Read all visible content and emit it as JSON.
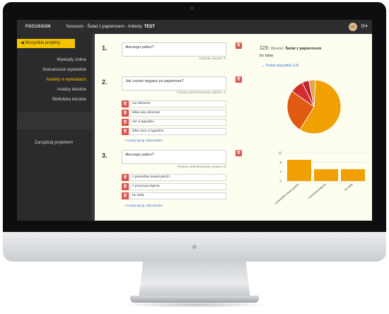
{
  "header": {
    "logo": "FOCUSSON",
    "crumb_app": "focusson",
    "crumb_sep": " · ",
    "crumb_project": "Świat z papierosem",
    "crumb_dash": " - Ankiety: ",
    "crumb_survey": "TEST",
    "avatar_text": "NAP"
  },
  "sidebar": {
    "all_projects": "Wszystkie projekty",
    "items": [
      "Wywiady online",
      "Scenariusze wywiadów",
      "Ankiety w wywiadach",
      "Analizy tekstów",
      "Biblioteka tekstów"
    ],
    "active_index": 2,
    "manage": "Zarządzaj projektem"
  },
  "questions": [
    {
      "num": "1.",
      "text": "dlaczego palisz?",
      "type": "Pytanie otwarte ✎",
      "options": []
    },
    {
      "num": "2.",
      "text": "Jak często sięgasz po papierosa?",
      "type": "Pytanie jednokrotnego wyboru ✔",
      "options": [
        "raz dziennie",
        "kilka razy dziennie",
        "raz w tygodniu",
        "kilka razy w tygodniu"
      ],
      "add_label": "+ Dodaj opcję odpowiedzi"
    },
    {
      "num": "3.",
      "text": "dlaczego palisz?",
      "type": "Pytanie wielokrotnego wyboru ☑",
      "options": [
        "z powodów towarzyskich",
        "z przyzwyczajenia",
        "bo lubię"
      ],
      "add_label": "+ Dodaj opcję odpowiedzi"
    }
  ],
  "right_panel": {
    "count": "123:",
    "interview_label": "Wywiad:",
    "interview_name": "Świat z papierosem",
    "answer": "bo lubię",
    "show_all": "⌄ Pokaż wszystkie (14)"
  },
  "colors": {
    "accent": "#f5c400",
    "sidebar_bg": "#2b2b2d",
    "danger": "#d9534f",
    "link": "#3a7bd5",
    "chart_bar": "#f0a000"
  },
  "chart_data": [
    {
      "type": "pie",
      "slices": [
        {
          "value": 58,
          "color": "#f0a000"
        },
        {
          "value": 26,
          "color": "#e05a12"
        },
        {
          "value": 8,
          "color": "#d12e2e"
        },
        {
          "value": 4,
          "color": "#c21f2f"
        },
        {
          "value": 4,
          "color": "#e0a84a"
        }
      ]
    },
    {
      "type": "bar",
      "categories": [
        "z powodów towarzyskich",
        "z przyzwyczajenia",
        "bo lubię"
      ],
      "values": [
        9,
        5,
        5
      ],
      "yticks": [
        "12",
        "8",
        "4",
        "0"
      ],
      "ylim": [
        0,
        12
      ],
      "grid": true
    }
  ]
}
